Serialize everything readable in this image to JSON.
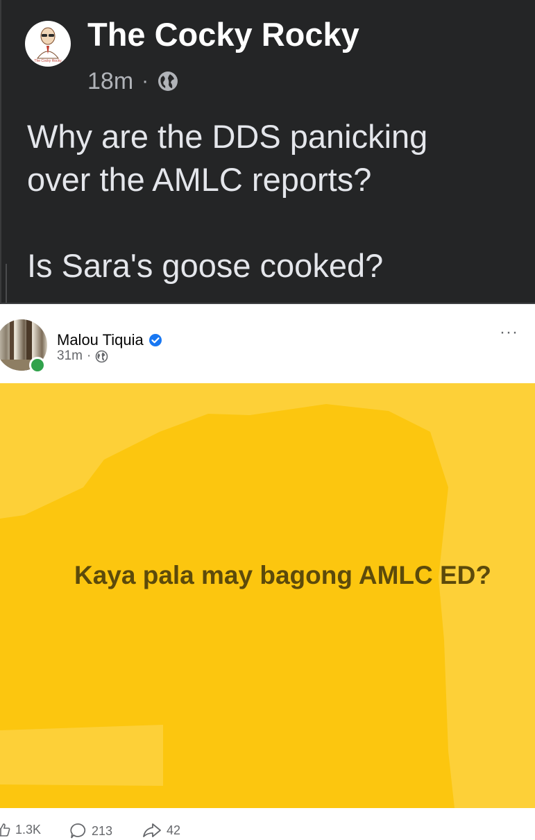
{
  "top_post": {
    "author": "The Cocky Rocky",
    "avatar_caption": "The Cocky Rocky",
    "time": "18m",
    "separator": "·",
    "privacy_icon": "globe-icon",
    "text_line1": "Why are the DDS panicking",
    "text_line2": "over the AMLC reports?",
    "text_line3": "Is Sara's goose cooked?"
  },
  "shared_post": {
    "author": "Malou Tiquia",
    "verified_icon": "verified-badge-icon",
    "time": "31m",
    "separator": "·",
    "privacy_icon": "globe-icon",
    "more_label": "···",
    "card_text": "Kaya pala may bagong AMLC ED?",
    "card_color": "#fdd23e",
    "online_color": "#31a24c"
  },
  "footer": {
    "likes": "1.3K",
    "comments": "213",
    "shares": "42"
  },
  "colors": {
    "dark_bg": "#242526",
    "verified": "#1877f2"
  }
}
